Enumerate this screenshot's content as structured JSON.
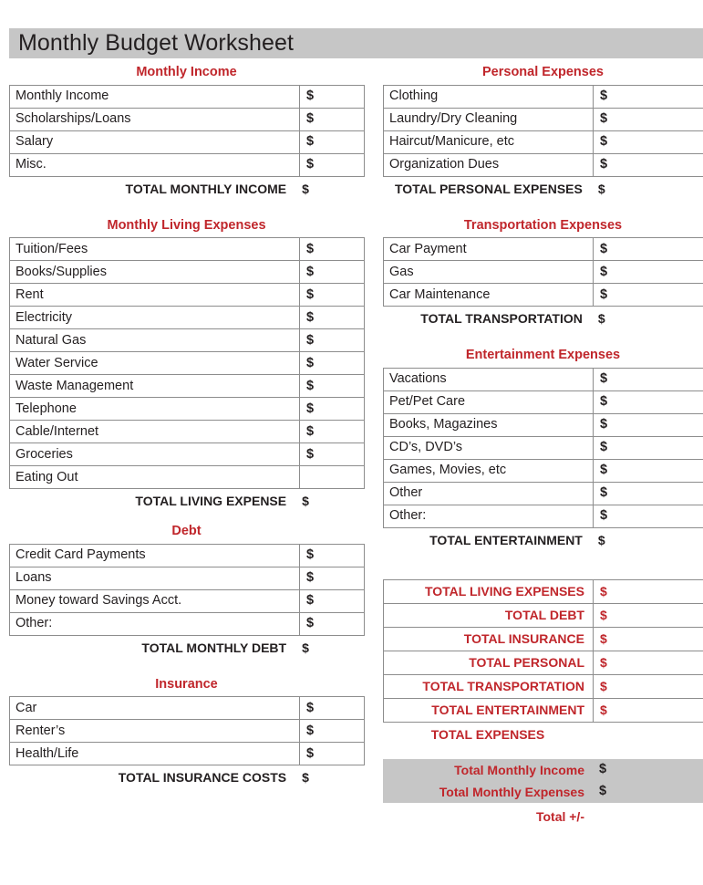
{
  "document": {
    "title": "Monthly Budget Worksheet",
    "currency_symbol": "$",
    "accent_red": "#C0262B",
    "shade_gray": "#C6C6C6",
    "text_dark": "#231F20"
  },
  "left_column": {
    "sections": [
      {
        "heading": "Monthly Income",
        "rows": [
          {
            "label": "Monthly Income",
            "amount": "$"
          },
          {
            "label": "Scholarships/Loans",
            "amount": "$"
          },
          {
            "label": "Salary",
            "amount": "$"
          },
          {
            "label": "Misc.",
            "amount": "$"
          }
        ],
        "total": {
          "label": "TOTAL MONTHLY INCOME",
          "amount": "$"
        }
      },
      {
        "heading": "Monthly Living Expenses",
        "rows": [
          {
            "label": "Tuition/Fees",
            "amount": "$"
          },
          {
            "label": "Books/Supplies",
            "amount": "$"
          },
          {
            "label": "Rent",
            "amount": "$"
          },
          {
            "label": "Electricity",
            "amount": "$"
          },
          {
            "label": "Natural Gas",
            "amount": "$"
          },
          {
            "label": "Water Service",
            "amount": "$"
          },
          {
            "label": "Waste Management",
            "amount": "$"
          },
          {
            "label": "Telephone",
            "amount": "$"
          },
          {
            "label": "Cable/Internet",
            "amount": "$"
          },
          {
            "label": "Groceries",
            "amount": "$"
          },
          {
            "label": "Eating Out",
            "amount": ""
          }
        ],
        "total": {
          "label": "TOTAL LIVING EXPENSE",
          "amount": "$"
        }
      },
      {
        "heading": "Debt",
        "rows": [
          {
            "label": "Credit Card Payments",
            "amount": "$"
          },
          {
            "label": "Loans",
            "amount": "$"
          },
          {
            "label": "Money toward Savings Acct.",
            "amount": "$"
          },
          {
            "label": "Other:",
            "amount": "$"
          }
        ],
        "total": {
          "label": "TOTAL MONTHLY DEBT",
          "amount": "$"
        }
      },
      {
        "heading": "Insurance",
        "rows": [
          {
            "label": "Car",
            "amount": "$"
          },
          {
            "label": "Renter’s",
            "amount": "$"
          },
          {
            "label": "Health/Life",
            "amount": "$"
          }
        ],
        "total": {
          "label": "TOTAL INSURANCE COSTS",
          "amount": "$"
        }
      }
    ]
  },
  "right_column": {
    "sections": [
      {
        "heading": "Personal Expenses",
        "rows": [
          {
            "label": "Clothing",
            "amount": "$"
          },
          {
            "label": "Laundry/Dry Cleaning",
            "amount": "$"
          },
          {
            "label": "Haircut/Manicure, etc",
            "amount": "$"
          },
          {
            "label": "Organization Dues",
            "amount": "$"
          }
        ],
        "total": {
          "label": "TOTAL PERSONAL EXPENSES",
          "amount": "$"
        }
      },
      {
        "heading": "Transportation Expenses",
        "rows": [
          {
            "label": "Car Payment",
            "amount": "$"
          },
          {
            "label": "Gas",
            "amount": "$"
          },
          {
            "label": "Car Maintenance",
            "amount": "$"
          }
        ],
        "total": {
          "label": "TOTAL TRANSPORTATION",
          "amount": "$"
        }
      },
      {
        "heading": "Entertainment Expenses",
        "rows": [
          {
            "label": "Vacations",
            "amount": "$"
          },
          {
            "label": "Pet/Pet Care",
            "amount": "$"
          },
          {
            "label": "Books, Magazines",
            "amount": "$"
          },
          {
            "label": "CD’s, DVD’s",
            "amount": "$"
          },
          {
            "label": "Games, Movies, etc",
            "amount": "$"
          },
          {
            "label": "Other",
            "amount": "$"
          },
          {
            "label": "Other:",
            "amount": "$"
          }
        ],
        "total": {
          "label": "TOTAL ENTERTAINMENT",
          "amount": "$"
        }
      }
    ],
    "summary": {
      "rows": [
        {
          "label": "TOTAL LIVING EXPENSES",
          "amount": "$"
        },
        {
          "label": "TOTAL DEBT",
          "amount": "$"
        },
        {
          "label": "TOTAL INSURANCE",
          "amount": "$"
        },
        {
          "label": "TOTAL PERSONAL",
          "amount": "$"
        },
        {
          "label": "TOTAL TRANSPORTATION",
          "amount": "$"
        },
        {
          "label": "TOTAL ENTERTAINMENT",
          "amount": "$"
        }
      ],
      "footer_label": "TOTAL EXPENSES"
    },
    "final_block": {
      "rows": [
        {
          "label": "Total Monthly Income",
          "amount": "$"
        },
        {
          "label": "Total Monthly Expenses",
          "amount": "$"
        }
      ],
      "net_label": "Total +/-"
    }
  }
}
